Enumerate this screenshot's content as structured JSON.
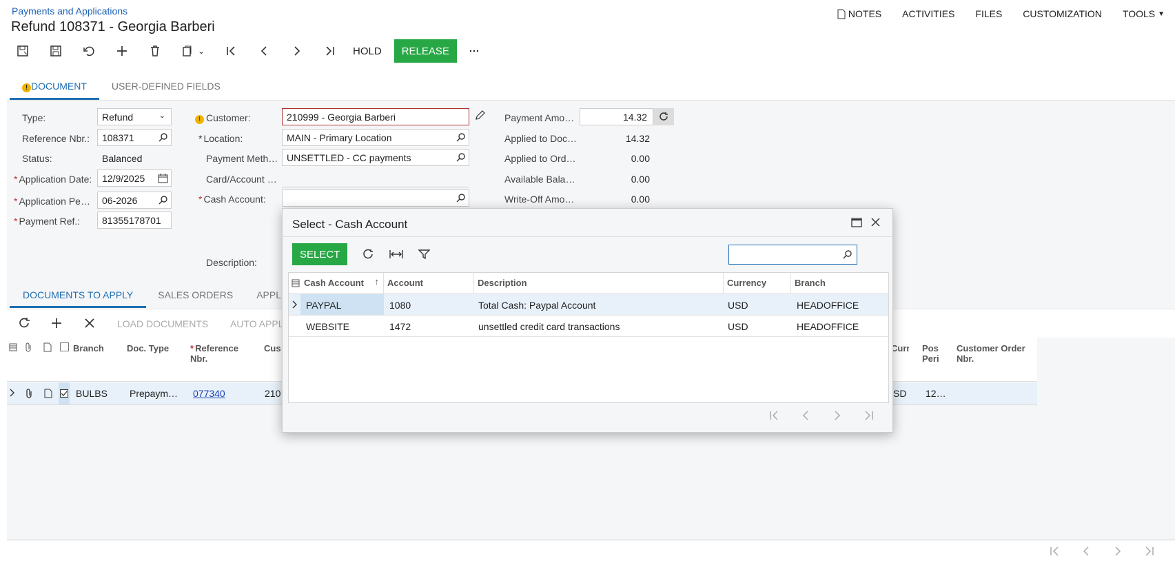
{
  "breadcrumb": "Payments and Applications",
  "page_title": "Refund 108371 - Georgia Barberi",
  "topnav": [
    "NOTES",
    "ACTIVITIES",
    "FILES",
    "CUSTOMIZATION",
    "TOOLS"
  ],
  "toolbar": {
    "hold": "HOLD",
    "release": "RELEASE",
    "more": "···"
  },
  "tabs": {
    "document": "DOCUMENT",
    "udf": "USER-DEFINED FIELDS"
  },
  "form": {
    "type_label": "Type:",
    "type_value": "Refund",
    "ref_label": "Reference Nbr.:",
    "ref_value": "108371",
    "status_label": "Status:",
    "status_value": "Balanced",
    "appdate_label": "Application Date:",
    "appdate_value": "12/9/2025",
    "appper_label": "Application Pe…",
    "appper_value": "06-2026",
    "payref_label": "Payment Ref.:",
    "payref_value": "81355178701",
    "customer_label": "Customer:",
    "customer_value": "210999 - Georgia Barberi",
    "location_label": "Location:",
    "location_value": "MAIN - Primary Location",
    "paymeth_label": "Payment Meth…",
    "paymeth_value": "UNSETTLED - CC payments",
    "card_label": "Card/Account …",
    "cash_label": "Cash Account:",
    "cash_value": "",
    "desc_label": "Description:",
    "payamt_label": "Payment Amo…",
    "payamt_value": "14.32",
    "appdoc_label": "Applied to Doc…",
    "appdoc_value": "14.32",
    "appord_label": "Applied to Ord…",
    "appord_value": "0.00",
    "avail_label": "Available Bala…",
    "avail_value": "0.00",
    "writeoff_label": "Write-Off Amo…",
    "writeoff_value": "0.00"
  },
  "subtabs": [
    "DOCUMENTS TO APPLY",
    "SALES ORDERS",
    "APPL"
  ],
  "grid_toolbar": {
    "load": "LOAD DOCUMENTS",
    "auto": "AUTO APPL"
  },
  "grid": {
    "headers": {
      "branch": "Branch",
      "doctype": "Doc. Type",
      "refnbr": "Reference Nbr.",
      "cust": "Cus",
      "curr": "Curre",
      "pos": "Pos Peri",
      "custorder": "Customer Order Nbr."
    },
    "row": {
      "branch": "BULBS",
      "doctype": "Prepaym…",
      "refnbr": "077340",
      "cust": "210",
      "curr": "SD",
      "pos": "12…"
    }
  },
  "dialog": {
    "title": "Select - Cash Account",
    "select": "SELECT",
    "search_placeholder": "",
    "headers": [
      "Cash Account",
      "Account",
      "Description",
      "Currency",
      "Branch"
    ],
    "rows": [
      {
        "cash": "PAYPAL",
        "account": "1080",
        "desc": "Total Cash: Paypal Account",
        "curr": "USD",
        "branch": "HEADOFFICE"
      },
      {
        "cash": "WEBSITE",
        "account": "1472",
        "desc": "unsettled credit card transactions",
        "curr": "USD",
        "branch": "HEADOFFICE"
      }
    ]
  },
  "colors": {
    "accent": "#1f6fb2",
    "green": "#28a745",
    "warn": "#f0b400"
  }
}
